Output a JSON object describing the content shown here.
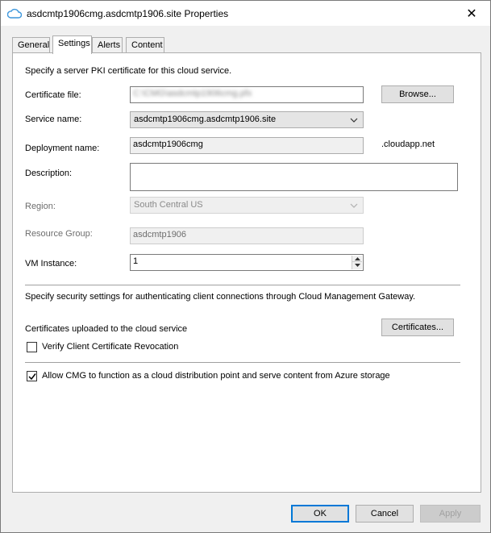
{
  "window": {
    "title": "asdcmtp1906cmg.asdcmtp1906.site Properties",
    "close_glyph": "✕"
  },
  "tabs": [
    {
      "label": "General",
      "active": false
    },
    {
      "label": "Settings",
      "active": true
    },
    {
      "label": "Alerts",
      "active": false
    },
    {
      "label": "Content",
      "active": false
    }
  ],
  "settings": {
    "pki_intro": "Specify a server PKI certificate for this cloud service.",
    "certificate_file_label": "Certificate file:",
    "certificate_file_value": "C:\\CMG\\asdcmtp1906cmg.pfx",
    "browse_label": "Browse...",
    "service_name_label": "Service name:",
    "service_name_value": "asdcmtp1906cmg.asdcmtp1906.site",
    "deployment_name_label": "Deployment name:",
    "deployment_name_value": "asdcmtp1906cmg",
    "deployment_suffix": ".cloudapp.net",
    "description_label": "Description:",
    "description_value": "",
    "region_label": "Region:",
    "region_value": "South Central US",
    "resource_group_label": "Resource Group:",
    "resource_group_value": "asdcmtp1906",
    "vm_instance_label": "VM Instance:",
    "vm_instance_value": "1",
    "security_intro": "Specify security settings for authenticating client connections through Cloud Management Gateway.",
    "certs_uploaded_label": "Certificates uploaded to the cloud service",
    "certificates_button_label": "Certificates...",
    "verify_revocation_label": "Verify Client Certificate Revocation",
    "verify_revocation_checked": false,
    "allow_cdp_label": "Allow CMG to function as a cloud distribution point and serve content from Azure storage",
    "allow_cdp_checked": true
  },
  "footer": {
    "ok_label": "OK",
    "cancel_label": "Cancel",
    "apply_label": "Apply"
  },
  "colors": {
    "accent": "#0078d7",
    "cloud_icon": "#3c96dc"
  }
}
